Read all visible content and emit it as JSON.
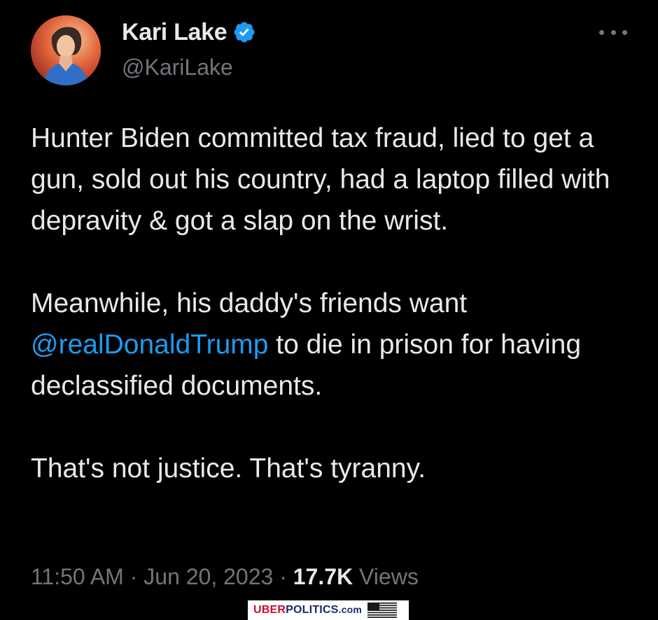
{
  "tweet": {
    "display_name": "Kari Lake",
    "handle": "@KariLake",
    "paragraph1": "Hunter Biden committed tax fraud, lied to get a gun, sold out his country, had a laptop filled with depravity & got a slap on the wrist.",
    "paragraph2_before": "Meanwhile, his daddy's friends want ",
    "paragraph2_mention": "@realDonaldTrump",
    "paragraph2_after": " to die in prison for having declassified documents.",
    "paragraph3": "That's not justice. That's tyranny.",
    "time": "11:50 AM",
    "separator": "·",
    "date": "Jun 20, 2023",
    "views_count": "17.7K",
    "views_label": "Views"
  },
  "watermark": {
    "part1": "UBER",
    "part2": "POLITICS",
    "part3": ".com"
  },
  "icons": {
    "verified": "verified-badge-icon",
    "more": "more-options-icon",
    "flag": "us-flag-icon"
  },
  "colors": {
    "background": "#000000",
    "text": "#e7e9ea",
    "secondary": "#71767b",
    "mention": "#1d9bf0",
    "verified": "#1d9bf0"
  }
}
